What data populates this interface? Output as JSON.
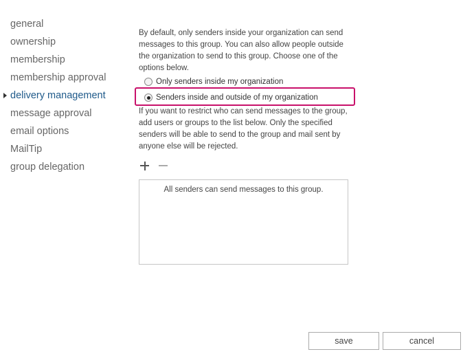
{
  "nav": {
    "items": [
      {
        "label": "general"
      },
      {
        "label": "ownership"
      },
      {
        "label": "membership"
      },
      {
        "label": "membership approval"
      },
      {
        "label": "delivery management",
        "selected": true
      },
      {
        "label": "message approval"
      },
      {
        "label": "email options"
      },
      {
        "label": "MailTip"
      },
      {
        "label": "group delegation"
      }
    ]
  },
  "delivery": {
    "intro": "By default, only senders inside your organization can send messages to this group. You can also allow people outside the organization to send to this group. Choose one of the options below.",
    "options": [
      {
        "label": "Only senders inside my organization",
        "checked": false
      },
      {
        "label": "Senders inside and outside of my organization",
        "checked": true
      }
    ],
    "restrict_text": "If you want to restrict who can send messages to the group, add users or groups to the list below. Only the specified senders will be able to send to the group and mail sent by anyone else will be rejected.",
    "add_icon": "plus-icon",
    "remove_icon": "minus-icon",
    "empty_list_text": "All senders can send messages to this group."
  },
  "footer": {
    "save_label": "save",
    "cancel_label": "cancel"
  },
  "colors": {
    "selected_nav": "#1f5a8a",
    "highlight": "#c8106a"
  }
}
